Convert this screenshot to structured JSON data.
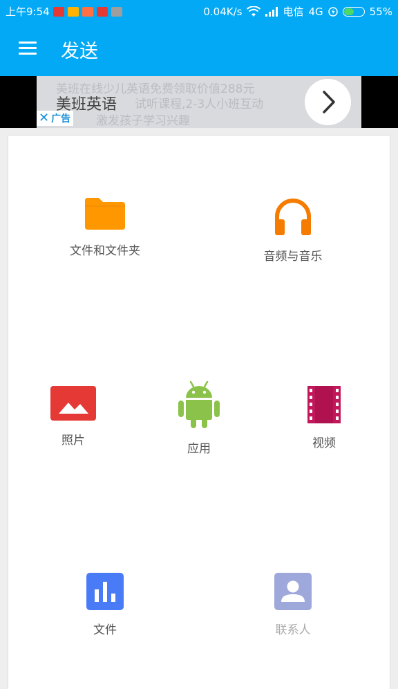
{
  "status_bar": {
    "time": "上午9:54",
    "speed": "0.04K/s",
    "carrier": "电信",
    "network": "4G",
    "battery_percent": "55%",
    "battery_level": 0.55,
    "app_icons": [
      "news-app-icon",
      "message-app-icon",
      "game-app-icon",
      "news-app-icon",
      "notice-app-icon"
    ],
    "app_icon_colors": [
      "#e53935",
      "#ffb300",
      "#ff7043",
      "#e53935",
      "#9e9e9e"
    ]
  },
  "app_bar": {
    "title": "发送",
    "menu_icon": "hamburger-menu-icon"
  },
  "ad": {
    "line1": "美班在线少儿英语免费领取价值288元",
    "line2": "试听课程,2-3人小班互动",
    "line3": "激发孩子学习兴趣",
    "brand": "美班英语",
    "tag": "广告",
    "close_icon": "close-icon",
    "arrow_icon": "chevron-right-icon"
  },
  "items": {
    "files_folders": {
      "label": "文件和文件夹",
      "icon": "folder-icon",
      "color": "#ff9800"
    },
    "audio_music": {
      "label": "音频与音乐",
      "icon": "headphones-icon",
      "color": "#f57c00"
    },
    "photos": {
      "label": "照片",
      "icon": "image-icon",
      "color": "#e53935"
    },
    "apps": {
      "label": "应用",
      "icon": "android-icon",
      "color": "#8bc34a"
    },
    "videos": {
      "label": "视频",
      "icon": "film-icon",
      "color": "#c2185b"
    },
    "documents": {
      "label": "文件",
      "icon": "bar-chart-icon",
      "color": "#4a7bf7"
    },
    "contacts": {
      "label": "联系人",
      "icon": "contact-icon",
      "color": "#9fa8da"
    }
  },
  "colors": {
    "primary": "#03a9f4",
    "background": "#eeeeee",
    "card": "#ffffff"
  }
}
